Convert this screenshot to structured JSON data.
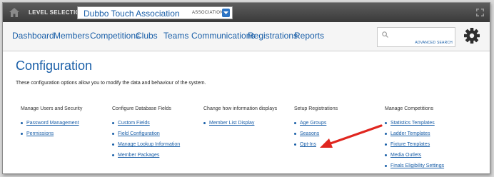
{
  "topbar": {
    "level_label": "LEVEL SELECTION",
    "level_value": "Dubbo Touch Association",
    "level_type": "ASSOCIATION"
  },
  "nav": {
    "items": [
      {
        "label": "Dashboard"
      },
      {
        "label": "Members"
      },
      {
        "label": "Competitions"
      },
      {
        "label": "Clubs"
      },
      {
        "label": "Teams"
      },
      {
        "label": "Communications"
      },
      {
        "label": "Registrations"
      },
      {
        "label": "Reports"
      }
    ],
    "search_placeholder": "",
    "advanced_search": "ADVANCED SEARCH"
  },
  "page": {
    "title": "Configuration",
    "description": "These configuration options allow you to modify the data and behaviour of the system."
  },
  "sections": [
    {
      "heading": "Manage Users and Security",
      "links": [
        "Password Management",
        "Permissions"
      ]
    },
    {
      "heading": "Configure Database Fields",
      "links": [
        "Custom Fields",
        "Field Configuration",
        "Manage Lookup Information",
        "Member Packages"
      ]
    },
    {
      "heading": "Change how information displays",
      "links": [
        "Member List Display"
      ]
    },
    {
      "heading": "Setup Registrations",
      "links": [
        "Age Groups",
        "Seasons",
        "Opt-Ins"
      ]
    },
    {
      "heading": "Manage Competitions",
      "links": [
        "Statistics Templates",
        "Ladder Templates",
        "Fixture Templates",
        "Media Outlets",
        "Finals Eligibility Settings"
      ]
    }
  ],
  "icons": {
    "home": "home-icon",
    "dropdown": "chevron-down-icon",
    "expand": "expand-icon",
    "search": "search-icon",
    "settings": "gear-icon",
    "annotation": "red-arrow-icon"
  },
  "colors": {
    "link": "#1a5fa8",
    "topbar": "#474747",
    "annotation": "#e0261f"
  }
}
